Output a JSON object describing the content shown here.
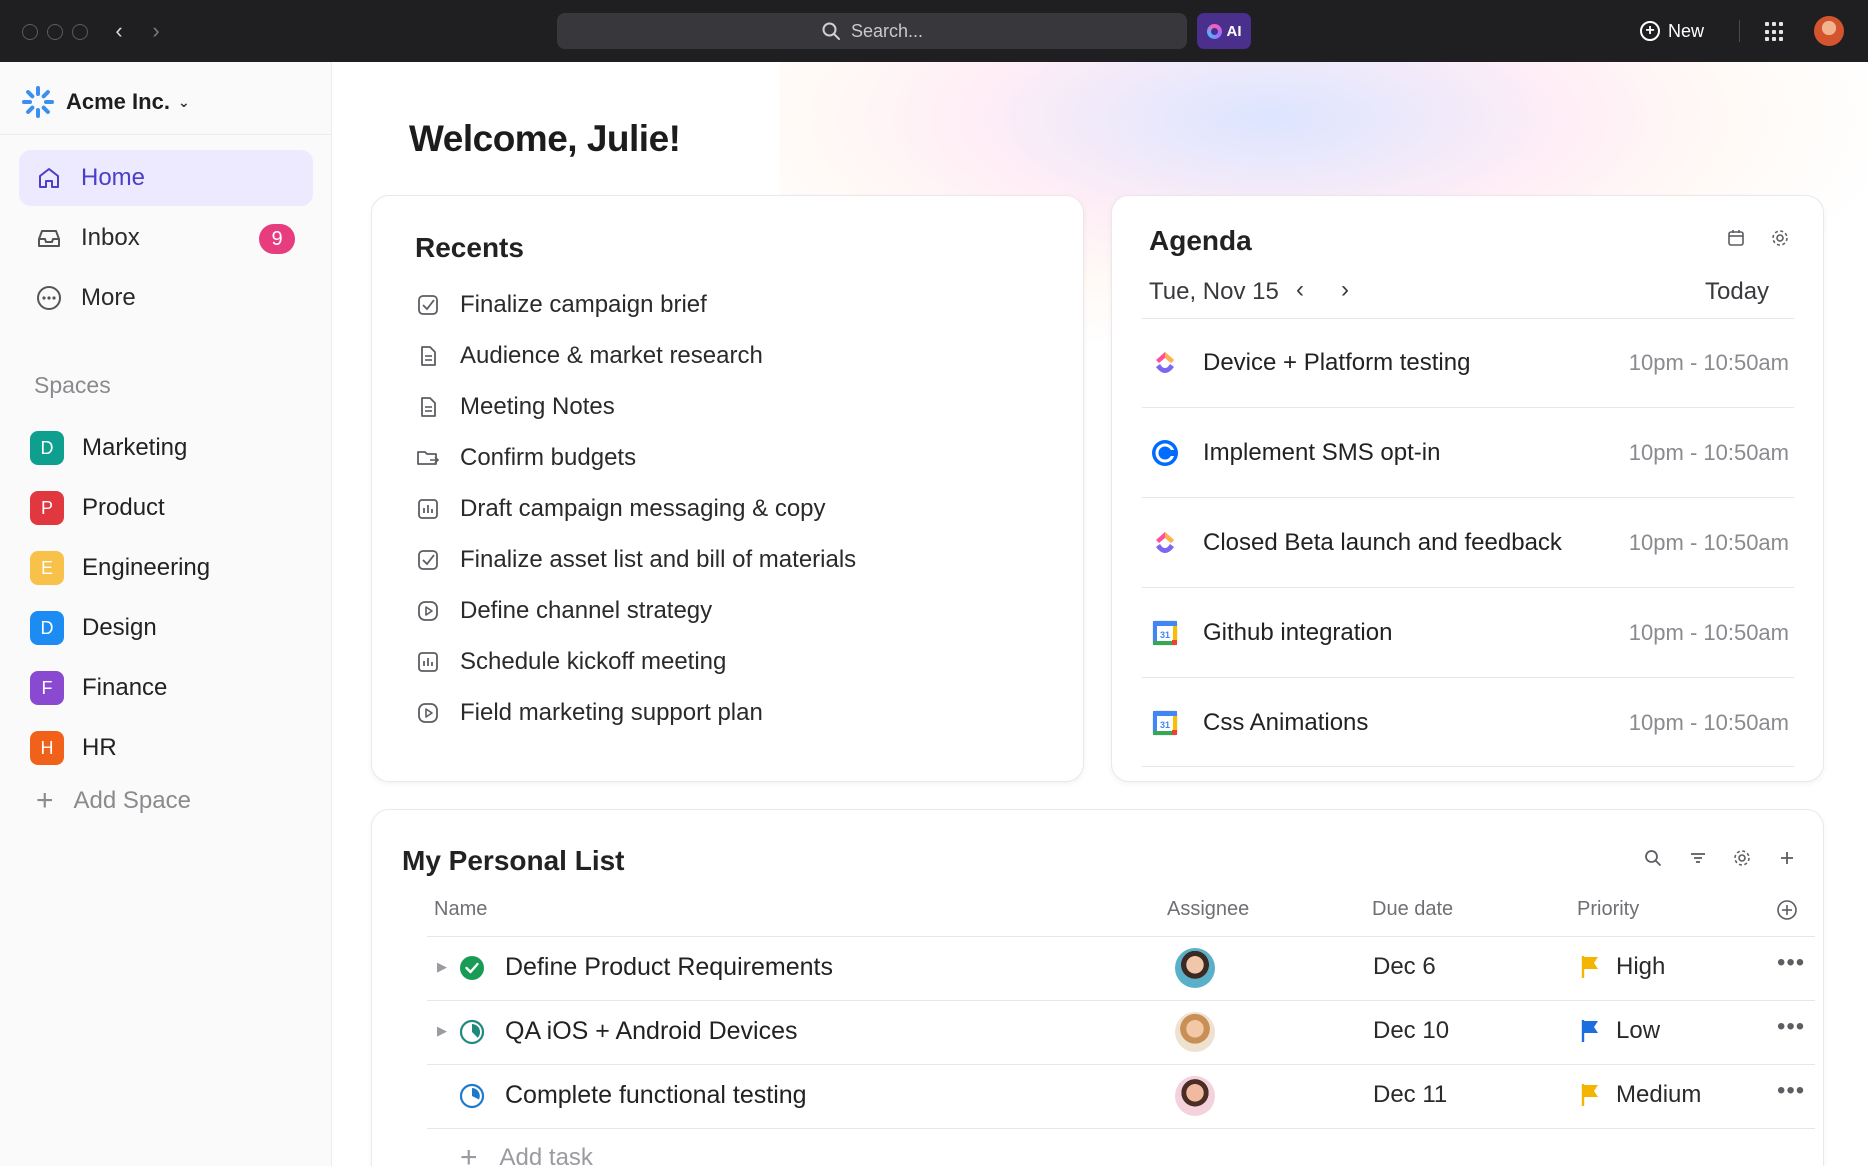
{
  "topbar": {
    "search_placeholder": "Search...",
    "ai_label": "AI",
    "new_label": "New"
  },
  "sidebar": {
    "workspace_name": "Acme Inc.",
    "nav": [
      {
        "label": "Home",
        "icon": "home-icon"
      },
      {
        "label": "Inbox",
        "icon": "inbox-icon",
        "badge": "9"
      },
      {
        "label": "More",
        "icon": "more-icon"
      }
    ],
    "spaces_title": "Spaces",
    "spaces": [
      {
        "initial": "D",
        "label": "Marketing",
        "color": "#0f9f8f"
      },
      {
        "initial": "P",
        "label": "Product",
        "color": "#e0383e"
      },
      {
        "initial": "E",
        "label": "Engineering",
        "color": "#f7c14a"
      },
      {
        "initial": "D",
        "label": "Design",
        "color": "#1d8cf2"
      },
      {
        "initial": "F",
        "label": "Finance",
        "color": "#8a49d1"
      },
      {
        "initial": "H",
        "label": "HR",
        "color": "#f2611a"
      }
    ],
    "add_space_label": "Add Space"
  },
  "main": {
    "welcome": "Welcome, Julie!"
  },
  "recents": {
    "title": "Recents",
    "items": [
      {
        "label": "Finalize campaign brief",
        "icon": "checkbox-icon"
      },
      {
        "label": "Audience & market research",
        "icon": "document-icon"
      },
      {
        "label": "Meeting Notes",
        "icon": "document-icon"
      },
      {
        "label": "Confirm budgets",
        "icon": "folder-sync-icon"
      },
      {
        "label": "Draft campaign messaging & copy",
        "icon": "chart-icon"
      },
      {
        "label": "Finalize asset list and bill of materials",
        "icon": "checkbox-icon"
      },
      {
        "label": "Define channel strategy",
        "icon": "play-icon"
      },
      {
        "label": "Schedule kickoff meeting",
        "icon": "chart-icon"
      },
      {
        "label": "Field marketing support plan",
        "icon": "play-icon"
      }
    ]
  },
  "agenda": {
    "title": "Agenda",
    "date": "Tue, Nov 15",
    "today_label": "Today",
    "events": [
      {
        "name": "Device + Platform testing",
        "time": "10pm - 10:50am",
        "source_icon": "clickup-logo-icon"
      },
      {
        "name": "Implement SMS opt-in",
        "time": "10pm - 10:50am",
        "source_icon": "calendly-logo-icon"
      },
      {
        "name": "Closed Beta launch and feedback",
        "time": "10pm - 10:50am",
        "source_icon": "clickup-logo-icon"
      },
      {
        "name": "Github integration",
        "time": "10pm - 10:50am",
        "source_icon": "google-calendar-icon"
      },
      {
        "name": "Css Animations",
        "time": "10pm - 10:50am",
        "source_icon": "google-calendar-icon"
      }
    ]
  },
  "personal_list": {
    "title": "My Personal List",
    "columns": [
      "Name",
      "Assignee",
      "Due date",
      "Priority"
    ],
    "tasks": [
      {
        "name": "Define Product Requirements",
        "status": "complete",
        "due": "Dec 6",
        "priority": "High",
        "priority_color": "#f5b400"
      },
      {
        "name": "QA iOS + Android Devices",
        "status": "in-progress",
        "due": "Dec 10",
        "priority": "Low",
        "priority_color": "#1d6fe0"
      },
      {
        "name": "Complete functional testing",
        "status": "in-review",
        "due": "Dec 11",
        "priority": "Medium",
        "priority_color": "#f5b400"
      }
    ],
    "add_task_label": "Add task"
  }
}
